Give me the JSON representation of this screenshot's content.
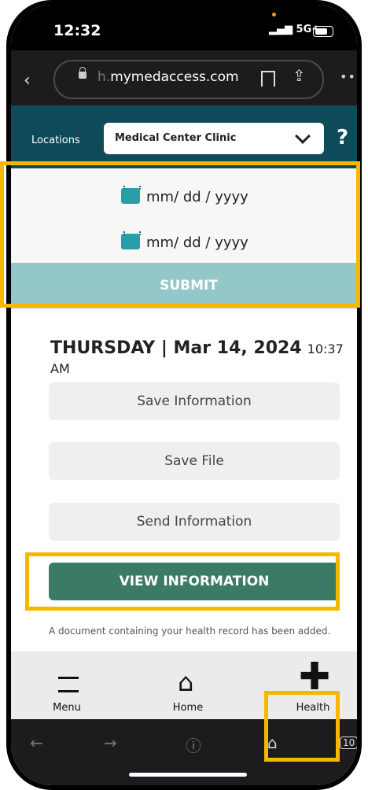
{
  "status": {
    "time": "12:32",
    "signal": "5G+"
  },
  "browser": {
    "url_prefix": "h.",
    "url_domain": "mymedaccess.com"
  },
  "locations": {
    "label": "Locations",
    "selected": "Medical Center Clinic",
    "help": "?"
  },
  "dates": {
    "start_placeholder": "mm/ dd / yyyy",
    "end_placeholder": "mm/ dd / yyyy",
    "submit_label": "SUBMIT"
  },
  "main": {
    "day": "THURSDAY | Mar 14, 2024",
    "time": "10:37 AM",
    "buttons": [
      "Save Information",
      "Save File",
      "Send Information"
    ],
    "view_button": "VIEW INFORMATION",
    "note": "A document containing your health record has been added."
  },
  "tabbar": {
    "menu": "Menu",
    "home": "Home",
    "health": "Health"
  },
  "browser_bottom": {
    "tabs_count": "10"
  },
  "colors": {
    "header": "#0f4a5b",
    "submit": "#94c7c8",
    "view_button": "#3a7a66",
    "highlight": "#f5b700"
  }
}
